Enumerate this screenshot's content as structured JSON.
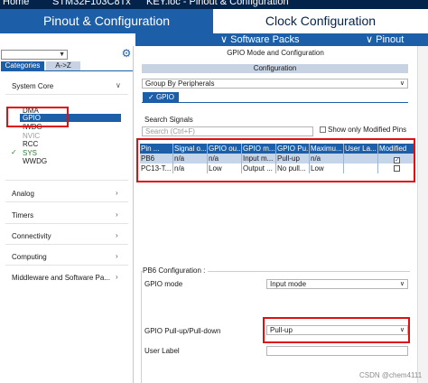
{
  "breadcrumb": {
    "home": "Home",
    "chip": "STM32F103C8Tx",
    "file": "KEY.ioc - Pinout & Configuration"
  },
  "tabs": {
    "pinout": "Pinout & Configuration",
    "clock": "Clock Configuration"
  },
  "subbar": {
    "software_packs": "∨ Software Packs",
    "pinout": "∨ Pinout"
  },
  "left": {
    "category_tab": "Categories",
    "az_tab": "A->Z",
    "system_core": "System Core",
    "items": [
      {
        "label": "DMA",
        "state": "normal"
      },
      {
        "label": "GPIO",
        "state": "selected"
      },
      {
        "label": "IWDG",
        "state": "normal"
      },
      {
        "label": "NVIC",
        "state": "grey"
      },
      {
        "label": "RCC",
        "state": "normal"
      },
      {
        "label": "SYS",
        "state": "ok"
      },
      {
        "label": "WWDG",
        "state": "normal"
      }
    ],
    "sections": [
      "Analog",
      "Timers",
      "Connectivity",
      "Computing",
      "Middleware and Software Pa..."
    ]
  },
  "right": {
    "title": "GPIO Mode and Configuration",
    "configuration": "Configuration",
    "group_by": "Group By Peripherals",
    "gpio_tab": "GPIO",
    "search_label": "Search Signals",
    "search_placeholder": "Search (Ctrl+F)",
    "show_modified": "Show only Modified Pins"
  },
  "table": {
    "headers": [
      "Pin ...",
      "Signal o...",
      "GPIO ou...",
      "GPIO m...",
      "GPIO Pu...",
      "Maximu...",
      "User La...",
      "Modified"
    ],
    "rows": [
      {
        "cells": [
          "PB6",
          "n/a",
          "n/a",
          "Input m...",
          "Pull-up",
          "n/a",
          ""
        ],
        "modified": true
      },
      {
        "cells": [
          "PC13-T...",
          "n/a",
          "Low",
          "Output ...",
          "No pull...",
          "Low",
          ""
        ],
        "modified": false
      }
    ]
  },
  "config": {
    "title": "PB6 Configuration :",
    "gpio_mode_label": "GPIO mode",
    "gpio_mode_value": "Input mode",
    "pull_label": "GPIO Pull-up/Pull-down",
    "pull_value": "Pull-up",
    "user_label": "User Label",
    "user_label_value": ""
  },
  "watermark": "CSDN @chem4111",
  "colors": {
    "brand": "#03234b",
    "accent": "#1c5fa8",
    "highlight": "#e01010"
  }
}
